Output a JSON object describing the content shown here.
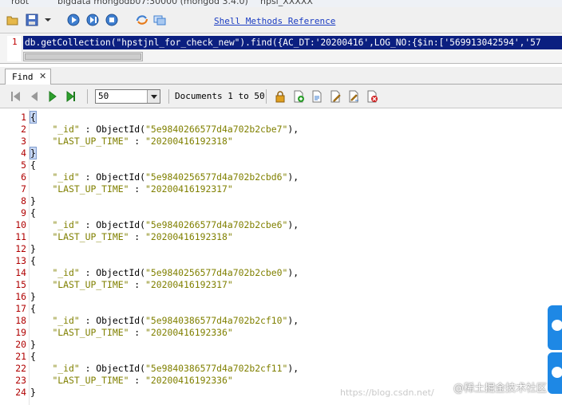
{
  "top_tabs": {
    "tab1": "root",
    "tab2": "bigdata mongodb07:30000 (mongod 3.4.0)",
    "tab3": "hpsi_XXXXX"
  },
  "toolbar": {
    "shell_methods_link": "Shell Methods Reference"
  },
  "query_editor": {
    "line_number": "1",
    "query_text": "db.getCollection(\"hpstjnl_for_check_new\").find({AC_DT:'20200416',LOG_NO:{$in:['569913042594','57"
  },
  "find_tab": {
    "label": "Find",
    "close": "✕"
  },
  "results_toolbar": {
    "page_size": "50",
    "documents_label": "Documents 1 to 50"
  },
  "documents": [
    {
      "id": "5e9840266577d4a702b2cbe7",
      "last_up_time": "20200416192318"
    },
    {
      "id": "5e9840256577d4a702b2cbd6",
      "last_up_time": "20200416192317"
    },
    {
      "id": "5e9840266577d4a702b2cbe6",
      "last_up_time": "20200416192318"
    },
    {
      "id": "5e9840256577d4a702b2cbe0",
      "last_up_time": "20200416192317"
    },
    {
      "id": "5e9840386577d4a702b2cf10",
      "last_up_time": "20200416192336"
    },
    {
      "id": "5e9840386577d4a702b2cf11",
      "last_up_time": "20200416192336"
    }
  ],
  "field_names": {
    "id_key": "\"_id\"",
    "time_key": "\"LAST_UP_TIME\""
  },
  "line_numbers": [
    "1",
    "2",
    "3",
    "4",
    "5",
    "6",
    "7",
    "8",
    "9",
    "10",
    "11",
    "12",
    "13",
    "14",
    "15",
    "16",
    "17",
    "18",
    "19",
    "20",
    "21",
    "22",
    "23",
    "24"
  ],
  "watermark": {
    "csdn": "https://blog.csdn.net/",
    "juejin": "@稀土掘金技术社区"
  },
  "colors": {
    "query_highlight": "#0b1f80",
    "string_color": "#808000",
    "line_number_color": "#b00000",
    "link_color": "#1a3cc2"
  }
}
